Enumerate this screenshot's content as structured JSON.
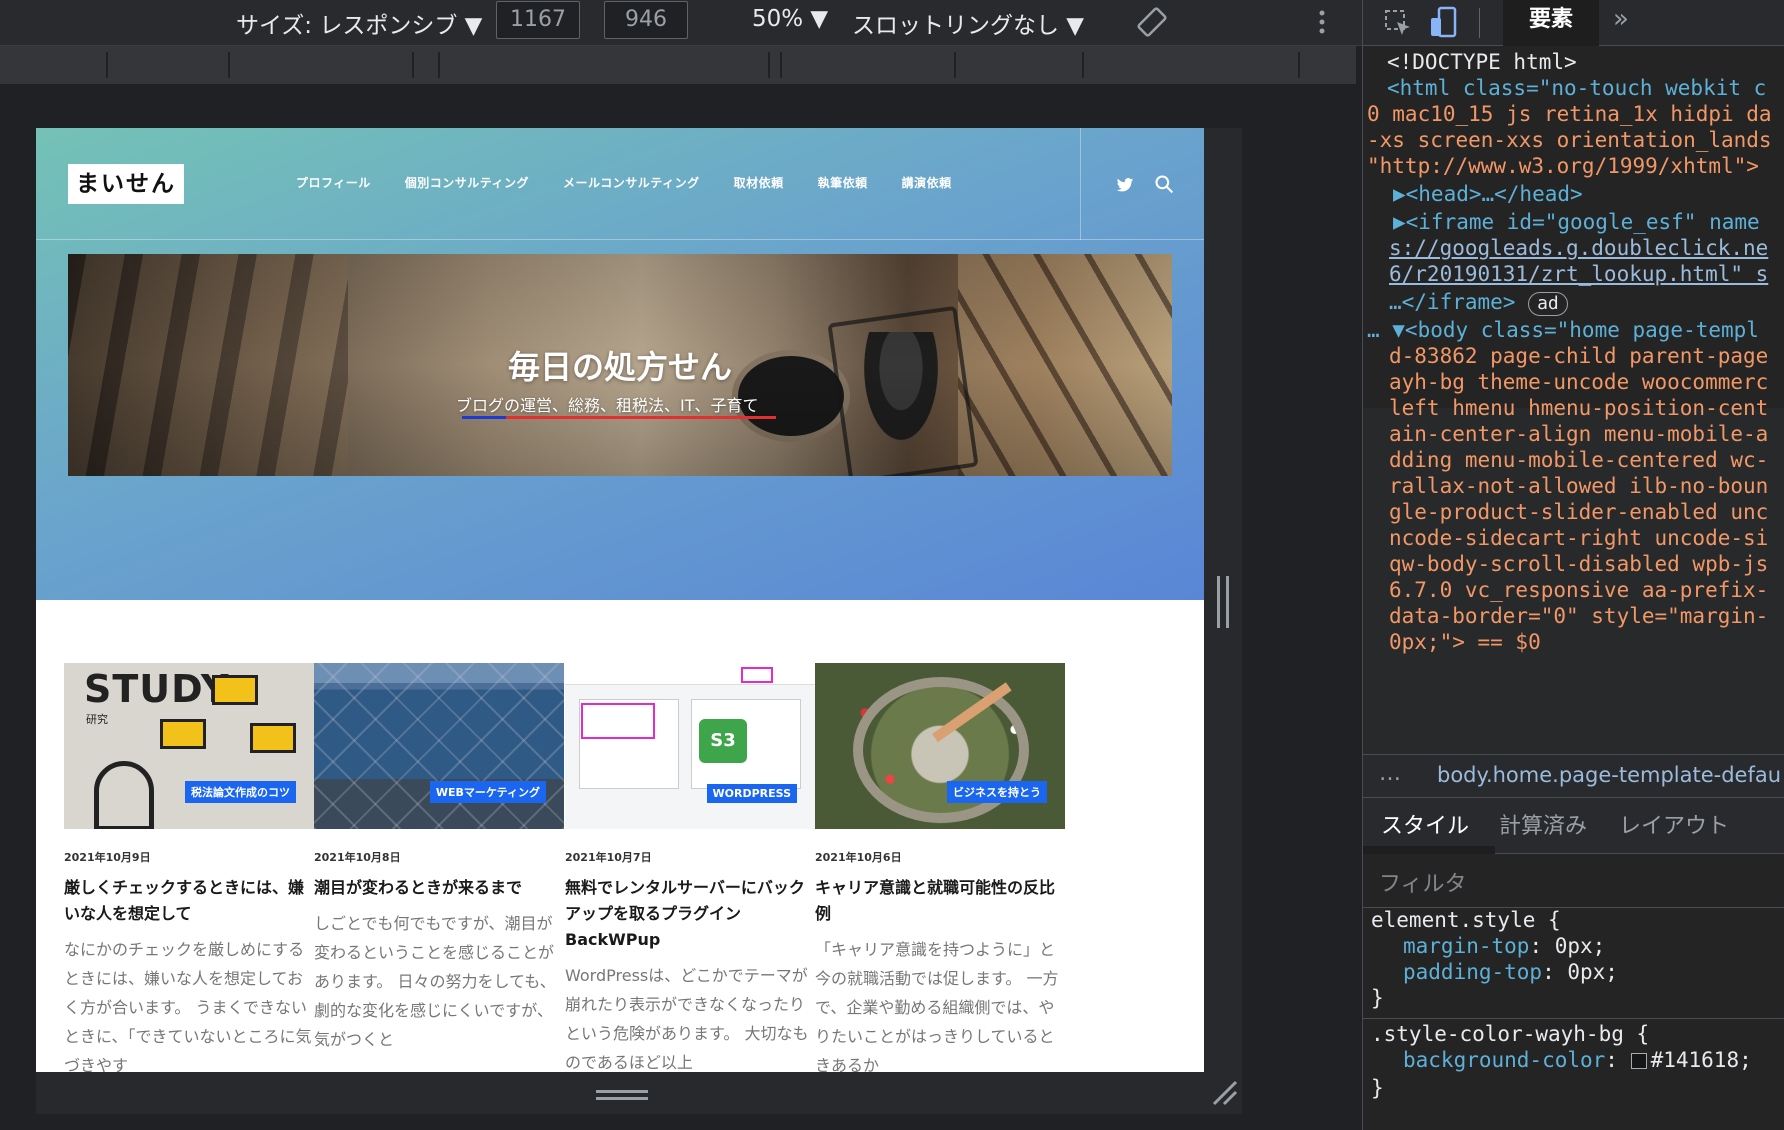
{
  "device_toolbar": {
    "size_label": "サイズ: レスポンシブ ▼",
    "width": "1167",
    "times": "✕",
    "height": "946",
    "zoom": "50% ▼",
    "throttling": "スロットリングなし ▼",
    "rotate_icon": "rotate-icon",
    "more_icon": "more-vertical-icon"
  },
  "site": {
    "logo": "まいせん",
    "nav": [
      "プロフィール",
      "個別コンサルティング",
      "メールコンサルティング",
      "取材依頼",
      "執筆依頼",
      "講演依頼"
    ],
    "icons": {
      "twitter": "twitter-icon",
      "search": "search-icon"
    },
    "banner": {
      "title": "毎日の処方せん",
      "subtitle": "ブログの運営、総務、租税法、IT、子育て"
    },
    "posts": [
      {
        "tag": "税法論文作成のコツ",
        "date": "2021年10月9日",
        "title": "厳しくチェックするときには、嫌いな人を想定して",
        "excerpt": "なにかのチェックを厳しめにするときには、嫌いな人を想定しておく方が合います。 うまくできないときに、「できていないところに気づきやす"
      },
      {
        "tag": "WEBマーケティング",
        "date": "2021年10月8日",
        "title": "潮目が変わるときが来るまで",
        "excerpt": "しごとでも何でもですが、潮目が変わるということを感じることがあります。 日々の努力をしても、劇的な変化を感じにくいですが、気がつくと"
      },
      {
        "tag": "WORDPRESS",
        "date": "2021年10月7日",
        "title": "無料でレンタルサーバーにバックアップを取るプラグイン BackWPup",
        "excerpt": "WordPressは、どこかでテーマが崩れたり表示ができなくなったりという危険があります。 大切なものであるほど以上"
      },
      {
        "tag": "ビジネスを持とう",
        "date": "2021年10月6日",
        "title": "キャリア意識と就職可能性の反比例",
        "excerpt": "「キャリア意識を持つように」と今の就職活動では促します。 一方で、企業や勤める組織側では、やりたいことがはっきりしているときあるか"
      }
    ],
    "thumb_texts": {
      "study": "STUDY",
      "kenkyu": "研究",
      "s3": "S3"
    }
  },
  "devtools": {
    "tab_elements": "要素",
    "tab_more": "»",
    "code_lines": [
      {
        "kind": "plain",
        "text": "<!DOCTYPE html>"
      },
      {
        "kind": "open",
        "text": "<html class=\"no-touch webkit c"
      },
      {
        "kind": "val",
        "text": "0 mac10_15 js retina_1x hidpi da"
      },
      {
        "kind": "val",
        "text": "-xs screen-xxs orientation_lands"
      },
      {
        "kind": "val",
        "text": "\"http://www.w3.org/1999/xhtml\">"
      },
      {
        "kind": "open",
        "text": "▶<head>…</head>"
      },
      {
        "kind": "open",
        "text": "▶<iframe id=\"google_esf\" name"
      },
      {
        "kind": "link",
        "text": "s://googleads.g.doubleclick.ne"
      },
      {
        "kind": "link",
        "text": "6/r20190131/zrt_lookup.html\" s"
      },
      {
        "kind": "open",
        "text": "…</iframe>"
      },
      {
        "kind": "open",
        "text": "… ▼<body class=\"home page-templ"
      },
      {
        "kind": "val",
        "text": "d-83862 page-child parent-page"
      },
      {
        "kind": "val",
        "text": "ayh-bg theme-uncode woocommerc"
      },
      {
        "kind": "val",
        "text": "left hmenu hmenu-position-cent"
      },
      {
        "kind": "val",
        "text": "ain-center-align menu-mobile-a"
      },
      {
        "kind": "val",
        "text": "dding menu-mobile-centered wc-"
      },
      {
        "kind": "val",
        "text": "rallax-not-allowed ilb-no-boun"
      },
      {
        "kind": "val",
        "text": "gle-product-slider-enabled unc"
      },
      {
        "kind": "val",
        "text": "ncode-sidecart-right uncode-si"
      },
      {
        "kind": "val",
        "text": "qw-body-scroll-disabled wpb-js"
      },
      {
        "kind": "val",
        "text": "6.7.0 vc_responsive aa-prefix-"
      },
      {
        "kind": "val",
        "text": "data-border=\"0\" style=\"margin-"
      },
      {
        "kind": "val",
        "text": "0px;\"> == $0"
      }
    ],
    "ad_badge": "ad",
    "breadcrumb_dots": "…",
    "breadcrumb": "body.home.page-template-defau",
    "style_tabs": [
      "スタイル",
      "計算済み",
      "レイアウト"
    ],
    "filter_placeholder": "フィルタ",
    "rule1_selector": "element.style {",
    "rule1_props": [
      {
        "name": "margin-top",
        "value": "0px;"
      },
      {
        "name": "padding-top",
        "value": "0px;"
      }
    ],
    "rule_close": "}",
    "rule2_selector": ".style-color-wayh-bg {",
    "rule2_prop": {
      "name": "background-color",
      "value": "#141618;"
    },
    "accent_color": "#1b66f0"
  }
}
